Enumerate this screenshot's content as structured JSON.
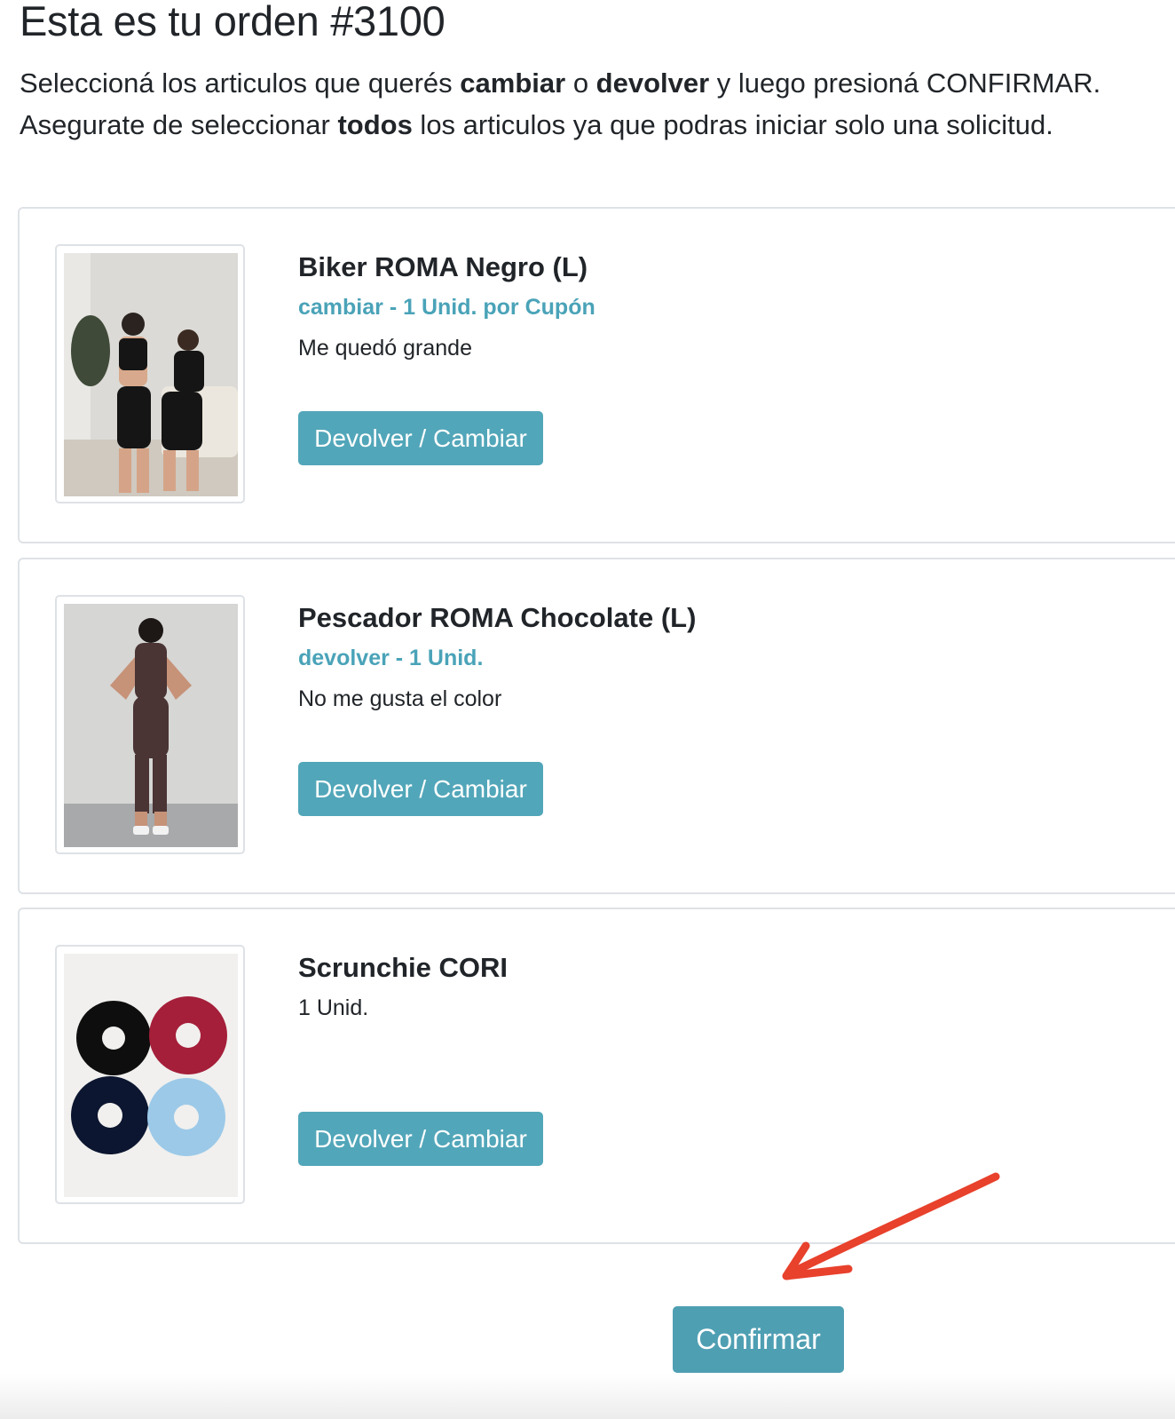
{
  "page": {
    "title": "Esta es tu orden #3100",
    "intro_line1": {
      "t1": "Seleccioná los articulos que querés ",
      "b1": "cambiar",
      "t2": " o ",
      "b2": "devolver",
      "t3": " y luego presioná CONFIRMAR."
    },
    "intro_line2": {
      "t1": "Asegurate de seleccionar ",
      "b1": "todos",
      "t2": " los articulos ya que podras iniciar solo una solicitud."
    }
  },
  "items": [
    {
      "name": "Biker ROMA Negro (L)",
      "status": "cambiar - 1 Unid. por Cupón",
      "reason": "Me quedó grande",
      "button_label": "Devolver / Cambiar"
    },
    {
      "name": "Pescador ROMA Chocolate (L)",
      "status": "devolver - 1 Unid.",
      "reason": "No me gusta el color",
      "button_label": "Devolver / Cambiar"
    },
    {
      "name": "Scrunchie CORI",
      "status": "1 Unid.",
      "button_label": "Devolver / Cambiar"
    }
  ],
  "confirm_label": "Confirmar",
  "colors": {
    "accent": "#52a6b9",
    "status_text": "#4aa3b8",
    "annotation_arrow": "#e8412c"
  }
}
